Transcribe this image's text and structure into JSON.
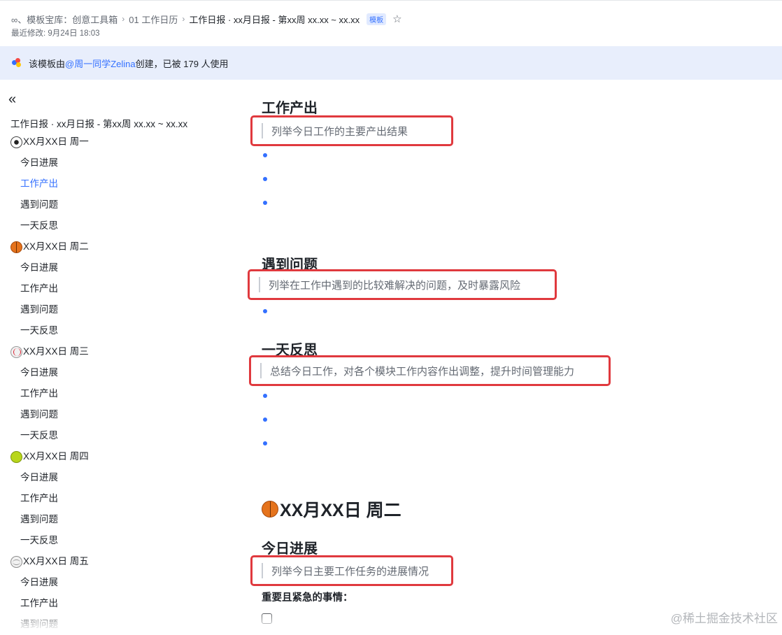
{
  "header": {
    "breadcrumbs": [
      "∞、模板宝库：创意工具箱",
      "01 工作日历",
      "工作日报 · xx月日报 - 第xx周 xx.xx ~ xx.xx"
    ],
    "badge": "模板",
    "last_modified": "最近修改: 9月24日 18:03"
  },
  "notice": {
    "prefix": "该模板由 ",
    "author": "@周一同学Zelina",
    "suffix": " 创建，已被 179 人使用"
  },
  "sidebar": {
    "doc_title": "工作日报 · xx月日报 - 第xx周 xx.xx ~ xx.xx",
    "days": [
      {
        "label": "XX月XX日 周一",
        "icon": "soccer-ball",
        "subs": [
          "今日进展",
          "工作产出",
          "遇到问题",
          "一天反思"
        ]
      },
      {
        "label": "XX月XX日 周二",
        "icon": "basketball",
        "subs": [
          "今日进展",
          "工作产出",
          "遇到问题",
          "一天反思"
        ]
      },
      {
        "label": "XX月XX日 周三",
        "icon": "baseball",
        "subs": [
          "今日进展",
          "工作产出",
          "遇到问题",
          "一天反思"
        ]
      },
      {
        "label": "XX月XX日 周四",
        "icon": "tennis-ball",
        "subs": [
          "今日进展",
          "工作产出",
          "遇到问题",
          "一天反思"
        ]
      },
      {
        "label": "XX月XX日 周五",
        "icon": "volleyball",
        "subs": [
          "今日进展",
          "工作产出",
          "遇到问题"
        ]
      }
    ],
    "active": "工作产出"
  },
  "main": {
    "section_output": {
      "heading": "工作产出",
      "quote": "列举今日工作的主要产出结果"
    },
    "section_problems": {
      "heading": "遇到问题",
      "quote": "列举在工作中遇到的比较难解决的问题，及时暴露风险"
    },
    "section_reflection": {
      "heading": "一天反思",
      "quote": "总结今日工作，对各个模块工作内容作出调整，提升时间管理能力"
    },
    "day_heading": "XX月XX日 周二",
    "section_progress": {
      "heading": "今日进展",
      "quote": "列举今日主要工作任务的进展情况"
    },
    "important_label": "重要且紧急的事情："
  },
  "watermark": "@稀土掘金技术社区"
}
